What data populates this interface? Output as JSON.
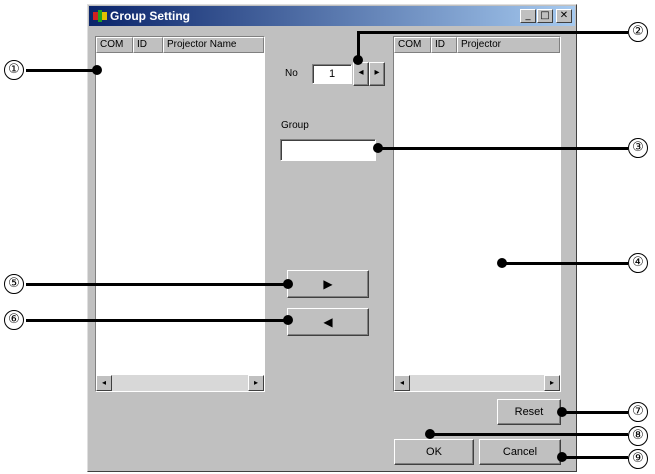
{
  "window": {
    "title": "Group Setting",
    "minimize": "_",
    "maximize": "□",
    "close": "✕"
  },
  "left_list": {
    "columns": [
      "COM",
      "ID",
      "Projector Name"
    ]
  },
  "right_list": {
    "columns": [
      "COM",
      "ID",
      "Projector"
    ]
  },
  "no_spinner": {
    "label": "No",
    "value": "1",
    "prev": "◂",
    "next": "▸"
  },
  "group": {
    "label": "Group",
    "value": ""
  },
  "scroll": {
    "left_arrow": "◂",
    "right_arrow": "▸"
  },
  "buttons": {
    "add": "▶",
    "remove": "◀",
    "reset": "Reset",
    "ok": "OK",
    "cancel": "Cancel"
  },
  "callouts": [
    "①",
    "②",
    "③",
    "④",
    "⑤",
    "⑥",
    "⑦",
    "⑧",
    "⑨"
  ]
}
